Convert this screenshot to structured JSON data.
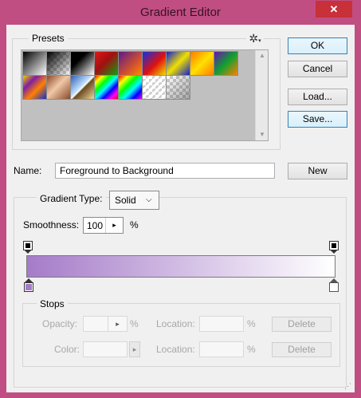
{
  "window": {
    "title": "Gradient Editor",
    "close_glyph": "✕"
  },
  "presets": {
    "label": "Presets",
    "menu_icon": "gear-icon",
    "swatches": [
      {
        "name": "foreground-to-background",
        "bg": "linear-gradient(135deg,#000 0%,#fff 100%)"
      },
      {
        "name": "foreground-to-transparent",
        "bg": "linear-gradient(135deg,#000 0%,rgba(0,0,0,0) 100%)",
        "checker": true
      },
      {
        "name": "black-white",
        "bg": "linear-gradient(135deg,#000 0%,#000 35%,#fff 100%)"
      },
      {
        "name": "red-green",
        "bg": "linear-gradient(135deg,#e01818 0%,#a01010 45%,#10a010 100%)"
      },
      {
        "name": "violet-orange",
        "bg": "linear-gradient(135deg,#5a1a8a 0%,#d05030 60%,#ff8a00 100%)"
      },
      {
        "name": "blue-red-yellow",
        "bg": "linear-gradient(135deg,#1030e0 0%,#e01010 55%,#f0e000 100%)"
      },
      {
        "name": "blue-yellow-blue",
        "bg": "linear-gradient(135deg,#1020d0 0%,#f0e000 50%,#1020d0 100%)"
      },
      {
        "name": "orange-yellow-orange",
        "bg": "linear-gradient(135deg,#ff7a00 0%,#ffe000 50%,#ff7a00 100%)"
      },
      {
        "name": "violet-green-orange",
        "bg": "linear-gradient(135deg,#6a10b0 0%,#10a030 50%,#ff8000 100%)"
      },
      {
        "name": "yellow-violet-orange-blue",
        "bg": "linear-gradient(135deg,#f0d000 0%,#8020a0 30%,#ff8000 60%,#1030d0 100%)"
      },
      {
        "name": "copper",
        "bg": "linear-gradient(135deg,#8a4a2a 0%,#f0c8a8 45%,#8a4a2a 100%)"
      },
      {
        "name": "chrome",
        "bg": "linear-gradient(135deg,#3060b0 0%,#c0e0ff 45%,#ffffff 50%,#6a4a20 55%,#f0d8a0 100%)"
      },
      {
        "name": "spectrum",
        "bg": "linear-gradient(135deg,#ff0000,#ffff00,#00ff00,#00ffff,#0000ff,#ff00ff,#ff0000)"
      },
      {
        "name": "transparent-rainbow",
        "bg": "linear-gradient(135deg,#ff0000,#ffff00,#00ff00,#00ffff,#0000ff,#ff00ff)",
        "checker": true
      },
      {
        "name": "transparent-stripes",
        "bg": "repeating-linear-gradient(135deg,rgba(255,255,255,0.9) 0 3px,rgba(255,255,255,0) 3px 6px)",
        "checker": true
      },
      {
        "name": "neutral-density",
        "bg": "linear-gradient(135deg,rgba(0,0,0,0) 0%,rgba(0,0,0,0.35) 100%)",
        "checker": true
      }
    ]
  },
  "buttons": {
    "ok": "OK",
    "cancel": "Cancel",
    "load": "Load...",
    "save": "Save...",
    "new": "New"
  },
  "name_field": {
    "label": "Name:",
    "value": "Foreground to Background"
  },
  "gradient": {
    "type_label": "Gradient Type:",
    "type_value": "Solid",
    "smoothness_label": "Smoothness:",
    "smoothness_value": "100",
    "smoothness_unit": "%",
    "start_color": "#a57bc9",
    "end_color": "#ffffff"
  },
  "stops": {
    "label": "Stops",
    "opacity_label": "Opacity:",
    "opacity_unit": "%",
    "opacity_location_label": "Location:",
    "opacity_location_unit": "%",
    "color_label": "Color:",
    "color_location_label": "Location:",
    "color_location_unit": "%",
    "delete_label": "Delete"
  },
  "colors": {
    "titlebar": "#c04e82",
    "accent": "#3c7fb1"
  }
}
